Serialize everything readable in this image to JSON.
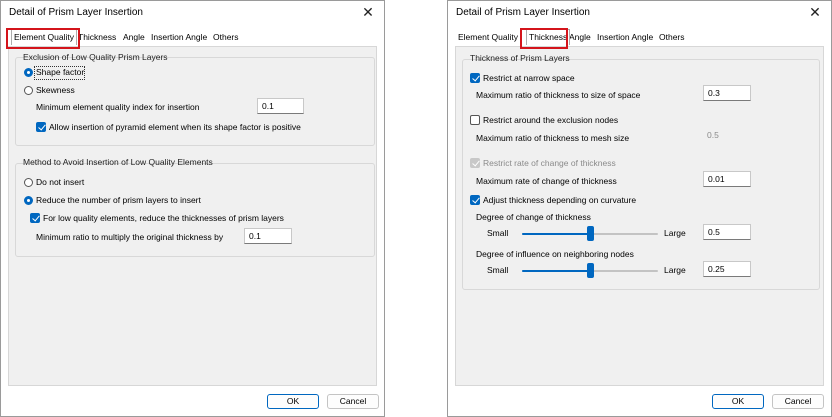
{
  "dialog_title": "Detail of Prism Layer Insertion",
  "close_glyph": "✕",
  "ok_label": "OK",
  "cancel_label": "Cancel",
  "tabs": [
    "Element Quality",
    "Thickness",
    "Angle",
    "Insertion Angle",
    "Others"
  ],
  "left": {
    "active_tab": "Element Quality",
    "exclusion": {
      "title": "Exclusion of Low Quality Prism Layers",
      "shape_factor": "Shape factor",
      "shape_factor_selected": true,
      "skewness": "Skewness",
      "skewness_selected": false,
      "min_quality_label": "Minimum element quality index for insertion",
      "min_quality_value": "0.1",
      "allow_pyramid": "Allow insertion of pyramid element when its shape factor is positive",
      "allow_pyramid_checked": true
    },
    "method": {
      "title": "Method to Avoid Insertion of Low Quality Elements",
      "do_not_insert": "Do not insert",
      "do_not_insert_selected": false,
      "reduce_layers": "Reduce the number of prism layers to insert",
      "reduce_layers_selected": true,
      "reduce_thickness": "For low quality elements, reduce the thicknesses of prism layers",
      "reduce_thickness_checked": true,
      "min_ratio_label": "Minimum ratio to multiply the original thickness by",
      "min_ratio_value": "0.1"
    }
  },
  "right": {
    "active_tab": "Thickness",
    "group_title": "Thickness of Prism Layers",
    "restrict_narrow": "Restrict at narrow space",
    "restrict_narrow_checked": true,
    "max_ratio_space_label": "Maximum ratio of thickness to size of space",
    "max_ratio_space_value": "0.3",
    "restrict_exclusion": "Restrict around the exclusion nodes",
    "restrict_exclusion_checked": false,
    "max_ratio_mesh_label": "Maximum ratio of thickness to mesh size",
    "max_ratio_mesh_value": "0.5",
    "restrict_rate": "Restrict rate of change of thickness",
    "restrict_rate_checked": true,
    "restrict_rate_enabled": false,
    "max_rate_label": "Maximum rate of change of thickness",
    "max_rate_value": "0.01",
    "adjust_curvature": "Adjust thickness depending on curvature",
    "adjust_curvature_checked": true,
    "degree_change_label": "Degree of change of thickness",
    "degree_change_small": "Small",
    "degree_change_large": "Large",
    "degree_change_value": "0.5",
    "degree_change_level": 0.5,
    "degree_influence_label": "Degree of influence on neighboring nodes",
    "degree_influence_small": "Small",
    "degree_influence_large": "Large",
    "degree_influence_value": "0.25",
    "degree_influence_level": 0.5
  },
  "colors": {
    "accent": "#0067c0",
    "highlight": "#d4141b"
  }
}
